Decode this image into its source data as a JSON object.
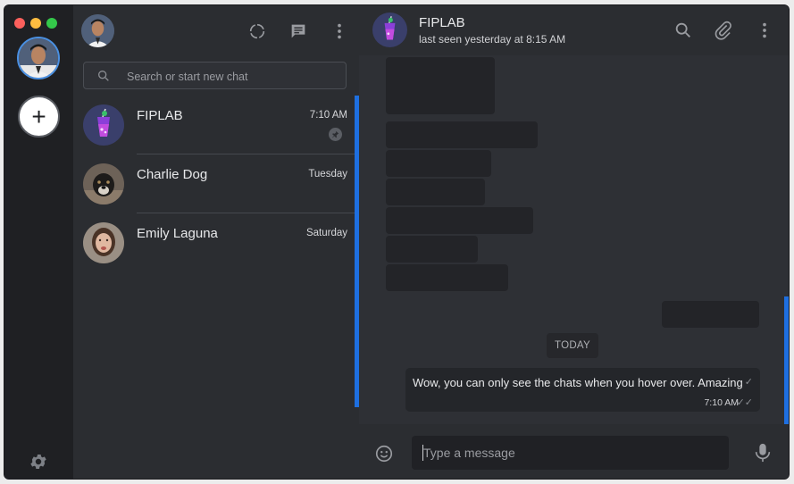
{
  "window": {
    "traffic_lights": [
      "close",
      "minimize",
      "zoom"
    ]
  },
  "rail": {
    "add_label": "+",
    "settings_icon": "gear-icon"
  },
  "list_header": {
    "icons": [
      "status-icon",
      "new-chat-icon",
      "menu-icon"
    ]
  },
  "search": {
    "placeholder": "Search or start new chat"
  },
  "chats": [
    {
      "name": "FIPLAB",
      "time": "7:10 AM",
      "pinned": true
    },
    {
      "name": "Charlie Dog",
      "time": "Tuesday",
      "pinned": false
    },
    {
      "name": "Emily Laguna",
      "time": "Saturday",
      "pinned": false
    }
  ],
  "conversation": {
    "name": "FIPLAB",
    "status": "last seen yesterday at 8:15 AM",
    "date_divider": "TODAY",
    "message": {
      "text": "Wow, you can only see the chats when you hover over. Amazing",
      "time": "7:10 AM",
      "status": "read"
    }
  },
  "composer": {
    "placeholder": "Type a message"
  },
  "colors": {
    "accent": "#1e6fe0",
    "background": "#2b2d31",
    "rail": "#1f2023"
  }
}
